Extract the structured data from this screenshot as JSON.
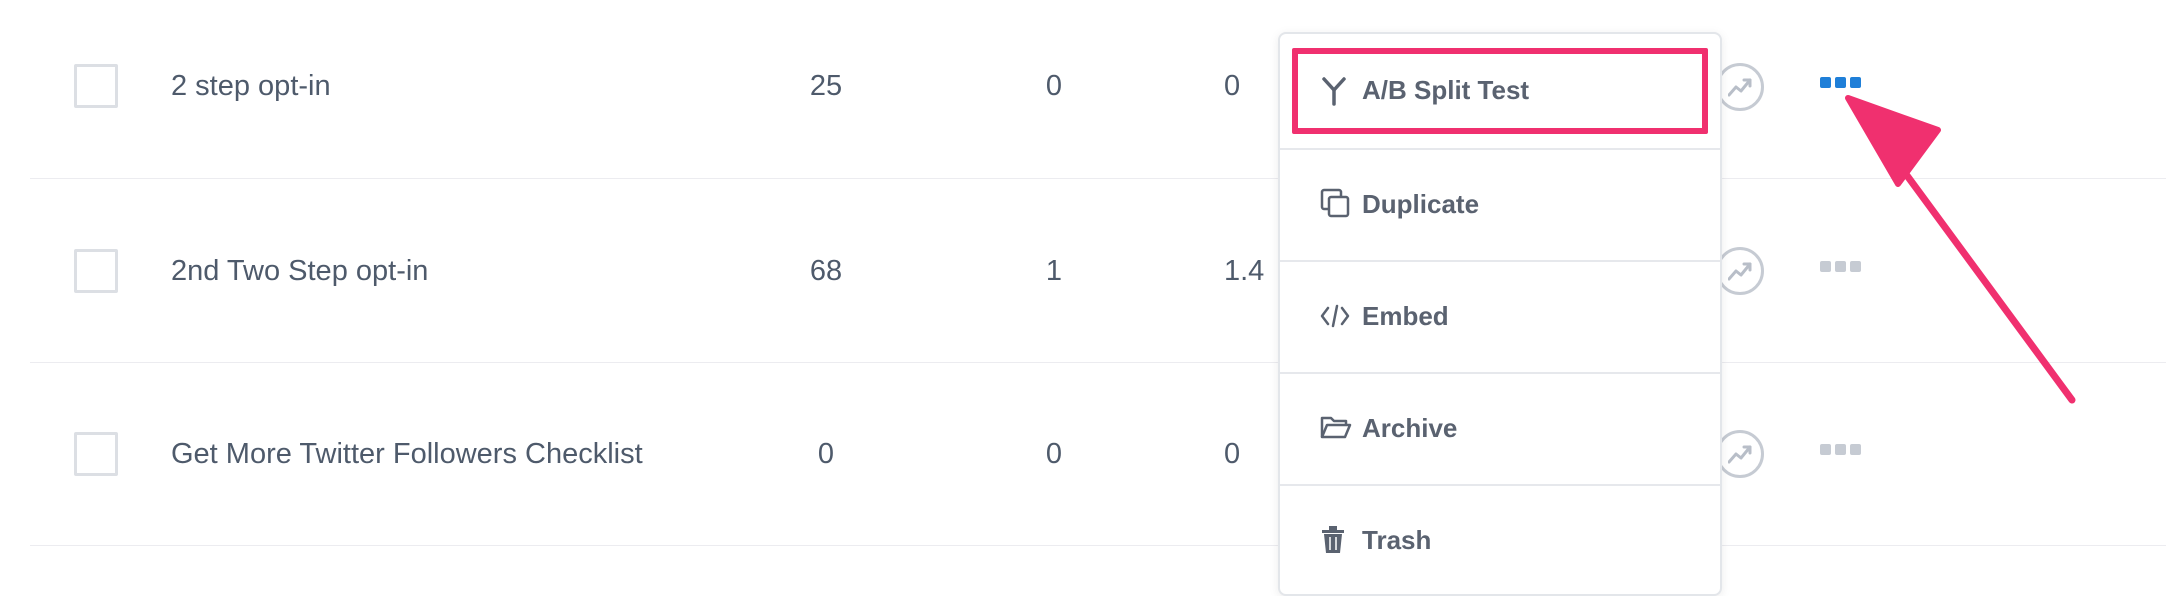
{
  "rows": [
    {
      "name": "2 step opt-in",
      "visits": "25",
      "conversions": "0",
      "rate": "0"
    },
    {
      "name": "2nd Two Step opt-in",
      "visits": "68",
      "conversions": "1",
      "rate": "1.4"
    },
    {
      "name": "Get More Twitter Followers Checklist",
      "visits": "0",
      "conversions": "0",
      "rate": "0"
    }
  ],
  "menu": {
    "items": [
      {
        "label": "A/B Split Test",
        "icon": "split-test-icon"
      },
      {
        "label": "Duplicate",
        "icon": "duplicate-icon"
      },
      {
        "label": "Embed",
        "icon": "code-icon"
      },
      {
        "label": "Archive",
        "icon": "folder-icon"
      },
      {
        "label": "Trash",
        "icon": "trash-icon"
      }
    ],
    "highlighted_item": "A/B Split Test"
  },
  "colors": {
    "active_dots": "#1f7fd8",
    "inactive_dots": "#c6cbd3",
    "annotation": "#f0306f"
  }
}
